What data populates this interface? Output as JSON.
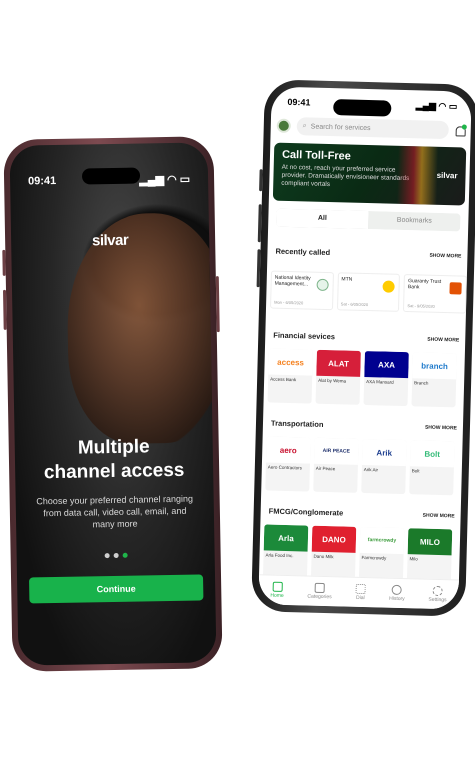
{
  "left_phone": {
    "time": "09:41",
    "brand": "silvar",
    "headline_1": "Multiple",
    "headline_2": "channel access",
    "subtext": "Choose your preferred channel ranging from data call, video call, email, and many more",
    "button": "Continue",
    "dots": 3,
    "active_dot": 3
  },
  "right_phone": {
    "time": "09:41",
    "search_placeholder": "Search for services",
    "banner": {
      "title": "Call Toll-Free",
      "subtitle": "At no cost, reach your preferred service provider. Dramatically envisioneer standards compliant vortals",
      "logo": "silvar"
    },
    "tabs": [
      "All",
      "Bookmarks"
    ],
    "recently_called": {
      "title": "Recently called",
      "show_more": "SHOW MORE",
      "items": [
        {
          "name": "National Identity Management...",
          "date": "Mon - 6/05/2020"
        },
        {
          "name": "MTN",
          "date": "Sat - 6/05/2020"
        },
        {
          "name": "Guaranty Trust Bank",
          "date": "Sat - 9/05/2020"
        }
      ]
    },
    "financial": {
      "title": "Financial sevices",
      "show_more": "SHOW MORE",
      "items": [
        "Access Bank",
        "Alat by Wema",
        "AXA Mansard",
        "Branch"
      ],
      "logos": [
        "access",
        "ALAT",
        "AXA",
        "branch"
      ]
    },
    "transportation": {
      "title": "Transportation",
      "show_more": "SHOW MORE",
      "items": [
        "Aero Contractors",
        "Air Peace",
        "Arik Air",
        "Bolt"
      ],
      "logos": [
        "aero",
        "AIR PEACE",
        "Arik",
        "Bolt"
      ]
    },
    "fmcg": {
      "title": "FMCG/Conglomerate",
      "show_more": "SHOW MORE",
      "items": [
        "Arla Food Inc.",
        "Dano Milk",
        "Farmcrowdy",
        "Milo"
      ],
      "logos": [
        "Arla",
        "DANO",
        "farmcrowdy",
        "MILO"
      ]
    },
    "nav": [
      "Home",
      "Categories",
      "Dial",
      "History",
      "Settings"
    ]
  }
}
